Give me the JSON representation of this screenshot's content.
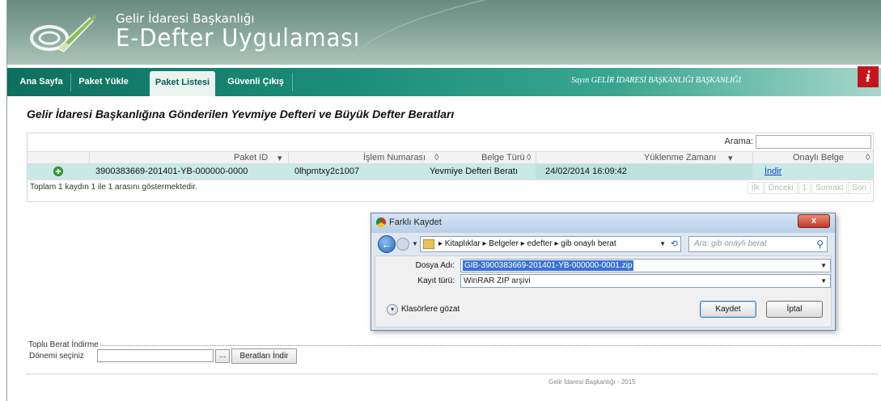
{
  "header": {
    "org_name": "Gelir İdaresi Başkanlığı",
    "app_name": "E-Defter Uygulaması"
  },
  "nav": {
    "tabs": [
      {
        "label": "Ana Sayfa",
        "active": false
      },
      {
        "label": "Paket Yükle",
        "active": false
      },
      {
        "label": "Paket Listesi",
        "active": true
      },
      {
        "label": "Güvenli Çıkış",
        "active": false
      }
    ],
    "greeting": "Sayın GELİR İDARESİ BAŞKANLIĞI BAŞKANLIĞI",
    "exit_icon": "exit-icon"
  },
  "page": {
    "title": "Gelir İdaresi Başkanlığına Gönderilen Yevmiye Defteri ve Büyük Defter Beratları"
  },
  "grid": {
    "search_label": "Arama:",
    "search_value": "",
    "columns": [
      "Paket ID",
      "İşlem Numarası",
      "Belge Türü",
      "Yüklenme Zamanı",
      "Onaylı Belge"
    ],
    "rows": [
      {
        "paket_id": "3900383669-201401-YB-000000-0000",
        "islem_no": "0lhpmtxy2c1007",
        "belge_turu": "Yevmiye Defteri Beratı",
        "yuklenme_zamani": "24/02/2014 16:09:42",
        "onayli_belge": "İndir"
      }
    ],
    "info": "Toplam 1 kaydın 1 ile 1 arasını göstermektedir.",
    "pager": [
      "İlk",
      "Önceki",
      "1",
      "Sonraki",
      "Son"
    ]
  },
  "dialog": {
    "title": "Farklı Kaydet",
    "close": "x",
    "breadcrumbs": "▸ Kitaplıklar ▸ Belgeler ▸ edefter ▸ gib onaylı berat",
    "search_placeholder": "Ara: gib onaylı berat",
    "file_name_label": "Dosya Adı:",
    "file_name": "GIB-3900383669-201401-YB-000000-0001.zip",
    "file_type_label": "Kayıt türü:",
    "file_type": "WinRAR ZIP arşivi",
    "browse_label": "Klasörlere gözat",
    "save_button": "Kaydet",
    "cancel_button": "İptal"
  },
  "toplu": {
    "legend": "Toplu Berat İndirme",
    "donem_label": "Dönemi seçiniz",
    "donem_value": "",
    "dots_button": "...",
    "download_button": "Beratları İndir"
  },
  "footer": {
    "text": "Gelir İdaresi Başkanlığı - 2015"
  }
}
